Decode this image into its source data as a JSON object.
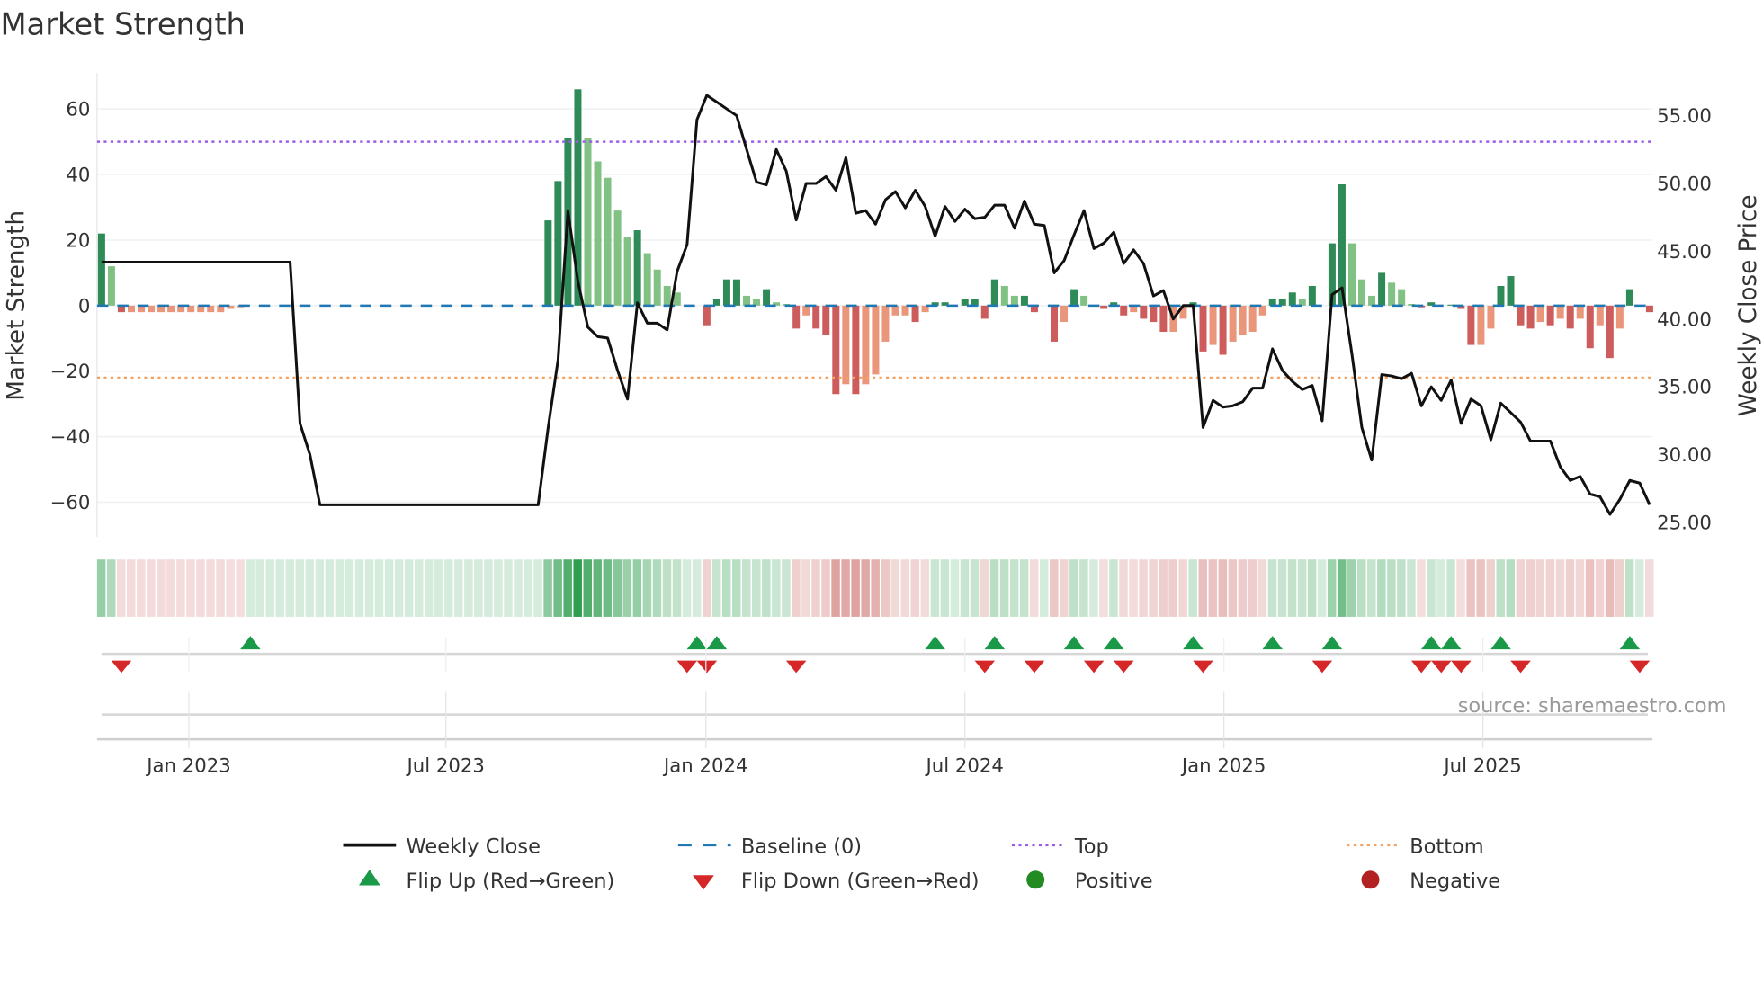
{
  "chart_data": {
    "type": "bar",
    "title": "Market Strength",
    "ylabel": "Market Strength",
    "y2label": "Weekly Close Price",
    "ylim": [
      -72,
      72
    ],
    "y2lim": [
      23.5,
      58.8
    ],
    "yticks": [
      60,
      40,
      20,
      0,
      -20,
      -40,
      -60
    ],
    "yticklabels": [
      "60",
      "40",
      "20",
      "0",
      "−20",
      "−40",
      "−60"
    ],
    "y2ticks": [
      55,
      50,
      45,
      40,
      35,
      30,
      25
    ],
    "y2ticklabels": [
      "55.00",
      "50.00",
      "45.00",
      "40.00",
      "35.00",
      "30.00",
      "25.00"
    ],
    "x_unit": "week index (week 0 ≈ early Nov 2022)",
    "xticks": [
      {
        "week": 8.8,
        "label": "Jan 2023"
      },
      {
        "week": 34.7,
        "label": "Jul 2023"
      },
      {
        "week": 60.9,
        "label": "Jan 2024"
      },
      {
        "week": 87.0,
        "label": "Jul 2024"
      },
      {
        "week": 113.1,
        "label": "Jan 2025"
      },
      {
        "week": 139.2,
        "label": "Jul 2025"
      }
    ],
    "top_level": 50,
    "bottom_level": -22,
    "baseline": 0,
    "strength": [
      22,
      12,
      -2,
      -2,
      -2,
      -2,
      -2,
      -2,
      -2,
      -2,
      -2,
      -2,
      -2,
      -1,
      -0.5,
      0,
      0,
      0,
      0,
      0,
      0,
      0,
      0,
      0,
      0,
      0,
      0,
      0,
      0,
      0,
      0,
      0,
      0,
      0,
      0,
      0,
      0,
      0,
      0,
      0,
      0,
      0,
      0,
      0,
      0,
      26,
      38,
      51,
      66,
      51,
      44,
      39,
      29,
      21,
      23,
      16,
      11,
      6,
      4,
      0,
      0,
      -6,
      2,
      8,
      8,
      3,
      2,
      5,
      1,
      0.5,
      -7,
      -3,
      -7,
      -9,
      -27,
      -24,
      -27,
      -24,
      -21,
      -11,
      -3,
      -3,
      -5,
      -2,
      1,
      1,
      0,
      2,
      2,
      -4,
      8,
      6,
      3,
      3,
      -2,
      0,
      -11,
      -5,
      5,
      3,
      0,
      -1,
      1,
      -3,
      -2,
      -4,
      -5,
      -8,
      -8,
      -4,
      1,
      -14,
      -12,
      -15,
      -11,
      -9,
      -8,
      -3,
      2,
      2,
      4,
      2,
      6,
      0,
      19,
      37,
      19,
      8,
      3,
      10,
      7,
      5,
      0.5,
      -0.5,
      1,
      0,
      0.3,
      -1,
      -12,
      -12,
      -7,
      6,
      9,
      -6,
      -7,
      -5,
      -6,
      -4,
      -7,
      -4,
      -13,
      -6,
      -16,
      -7,
      5,
      0,
      -2
    ],
    "weekly_close": [
      44.2,
      44.2,
      44.2,
      44.2,
      44.2,
      44.2,
      44.2,
      44.2,
      44.2,
      44.2,
      44.2,
      44.2,
      44.2,
      44.2,
      44.2,
      44.2,
      44.2,
      44.2,
      44.2,
      44.2,
      32.3,
      30,
      26.3,
      26.3,
      26.3,
      26.3,
      26.3,
      26.3,
      26.3,
      26.3,
      26.3,
      26.3,
      26.3,
      26.3,
      26.3,
      26.3,
      26.3,
      26.3,
      26.3,
      26.3,
      26.3,
      26.3,
      26.3,
      26.3,
      26.3,
      32,
      37,
      48,
      42.8,
      39.4,
      38.7,
      38.6,
      36.2,
      34.1,
      41.2,
      39.7,
      39.7,
      39.2,
      43.5,
      45.5,
      54.7,
      56.5,
      56,
      55.5,
      55,
      52.5,
      50.1,
      49.9,
      52.5,
      50.9,
      47.3,
      50,
      50,
      50.5,
      49.5,
      51.9,
      47.8,
      48,
      47,
      48.8,
      49.4,
      48.2,
      49.5,
      48.3,
      46.1,
      48.3,
      47.2,
      48.1,
      47.4,
      47.5,
      48.4,
      48.4,
      46.7,
      48.7,
      47,
      46.9,
      43.4,
      44.3,
      46.2,
      48,
      45.2,
      45.6,
      46.4,
      44.1,
      45.1,
      44.1,
      41.7,
      42.1,
      40,
      41,
      41,
      32,
      34,
      33.5,
      33.6,
      33.9,
      34.9,
      34.9,
      37.8,
      36.2,
      35.4,
      34.8,
      35.1,
      32.5,
      41.8,
      42.3,
      37.4,
      32,
      29.6,
      35.9,
      35.8,
      35.6,
      36,
      33.6,
      35,
      34,
      35.5,
      32.3,
      34.1,
      33.6,
      31.1,
      33.8,
      33.1,
      32.4,
      31,
      31,
      31,
      29.1,
      28.1,
      28.4,
      27.1,
      26.9,
      25.6,
      26.7,
      28.1,
      27.9,
      26.3
    ],
    "flip_up_weeks": [
      15,
      60,
      62,
      84,
      90,
      98,
      102,
      110,
      118,
      124,
      134,
      136,
      141,
      154
    ],
    "flip_down_weeks": [
      2,
      59,
      61,
      70,
      89,
      94,
      100,
      103,
      111,
      123,
      133,
      135,
      137,
      143,
      155
    ],
    "legend": [
      {
        "label": "Weekly Close",
        "kind": "line-solid",
        "color": "#111111"
      },
      {
        "label": "Baseline (0)",
        "kind": "line-dashed",
        "color": "#1f77b4"
      },
      {
        "label": "Top",
        "kind": "line-dotted",
        "color": "#9b5de5"
      },
      {
        "label": "Bottom",
        "kind": "line-dotted",
        "color": "#f4a261"
      },
      {
        "label": "Flip Up (Red→Green)",
        "kind": "triangle-up",
        "color": "#1a9a48"
      },
      {
        "label": "Flip Down (Green→Red)",
        "kind": "triangle-down",
        "color": "#d62728"
      },
      {
        "label": "Positive",
        "kind": "circle",
        "color": "#228b22"
      },
      {
        "label": "Negative",
        "kind": "circle",
        "color": "#b22222"
      }
    ],
    "legend_placement": "bottom-center",
    "source": "source: sharemaestro.com",
    "colors": {
      "pos_up": "#2e8b57",
      "pos_down": "#82c184",
      "neg_down": "#cd5c5c",
      "neg_up": "#e9967a",
      "strip_pos": "#2e9e4f",
      "strip_neg": "#c0504d",
      "grid": "#eef0f2"
    }
  }
}
